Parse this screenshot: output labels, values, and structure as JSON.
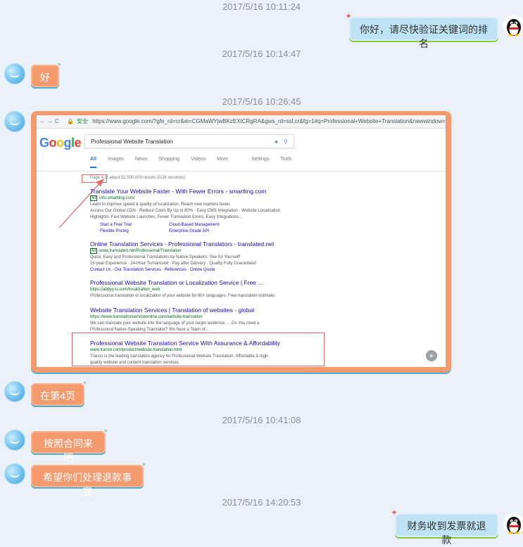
{
  "messages": {
    "ts1": "2017/5/16 10:11:24",
    "msg1": "你好，请尽快验证关键词的排名",
    "ts2": "2017/5/16 10:14:47",
    "msg2": "好",
    "ts3": "2017/5/16 10:26:45",
    "msg4": "在第4页",
    "ts4": "2017/5/16 10:41:08",
    "msg5": "按照合同来吧",
    "msg6": "希望你们处理退款事宜",
    "ts5": "2017/5/16 14:20:53",
    "msg7": "财务收到发票就退款"
  },
  "screenshot": {
    "secure_label": "安全",
    "url": "https://www.google.com/?gfe_rd=cr&ei=CGMaWYjwBKzEXtCRgRA&gws_rd=ssl,cr&fg=1#q=Professional+Website+Translation&newwindow=",
    "logo": "Google",
    "query": "Professional Website Translation",
    "tabs": [
      "All",
      "Images",
      "News",
      "Shopping",
      "Videos",
      "More"
    ],
    "tabs_right": [
      "Settings",
      "Tools"
    ],
    "stats": "Page 4 of about 52,500,000 results (0.38 seconds)",
    "results": [
      {
        "title": "Translate Your Website Faster - With Fewer Errors - smartling.com",
        "ad": "Ad",
        "url": "info.smartling.com/",
        "desc": [
          "Learn to improve speed & quality of localization. Reach new markets faster.",
          "Access Our Global CDN · Reduce Costs By Up to 80% · Easy CMS Integration · Website Localization",
          "Highlights: Fast Website Launches, Fewer Translation Errors, Easy Integrations..."
        ],
        "sitelinks": [
          "Start a Free Trial",
          "Cloud-Based Management",
          "Flexible Pricing",
          "Enterprise-Grade API"
        ]
      },
      {
        "title": "Online Translation Services - Professional Translators - translated.net",
        "ad": "Ad",
        "url": "www.translated.net/Professional/Translation",
        "desc": [
          "Quick, Easy and Professional Translations by Native Speakers. See for Yourself!",
          "15-year Experience · 24-Hour Turnaround · Pay after Delivery · Quality Fully Guaranteed",
          "Contact Us · Our Translation Services · References · Online Quote"
        ]
      },
      {
        "title": "Professional Website Translation or Localization Service | Free ...",
        "url": "https://abbyy-ls.com/localization_web",
        "desc": [
          "Professional translation or localization of your website for 80+ languages. Free translation estimate."
        ]
      },
      {
        "title": "Website Translation Services | Translation of websites - global",
        "url": "https://www.translationserviceonline.com/website-translation",
        "desc": [
          "We can translate your website into the language of your target audience. ... Do You need a",
          "Professional Native-Speaking Translator? We have a Team of..."
        ]
      },
      {
        "title": "Professional Website Translation Service With Assurance & Affordability",
        "url": "www.transn.com/product/website-translation.html",
        "desc": [
          "Transn is the leading translation agency for Professional Website Translation. Affordable & high-",
          "quality website and content translation services."
        ]
      }
    ]
  },
  "colors": {
    "orange_bubble": "#f59a6c",
    "blue_bubble": "#bfe3f5",
    "background": "#eaf1f8",
    "annotation_red": "#e06b6b"
  },
  "icons": [
    "avatar-left",
    "avatar-right-penguin",
    "zoom-in-icon",
    "microphone-icon",
    "search-icon"
  ]
}
